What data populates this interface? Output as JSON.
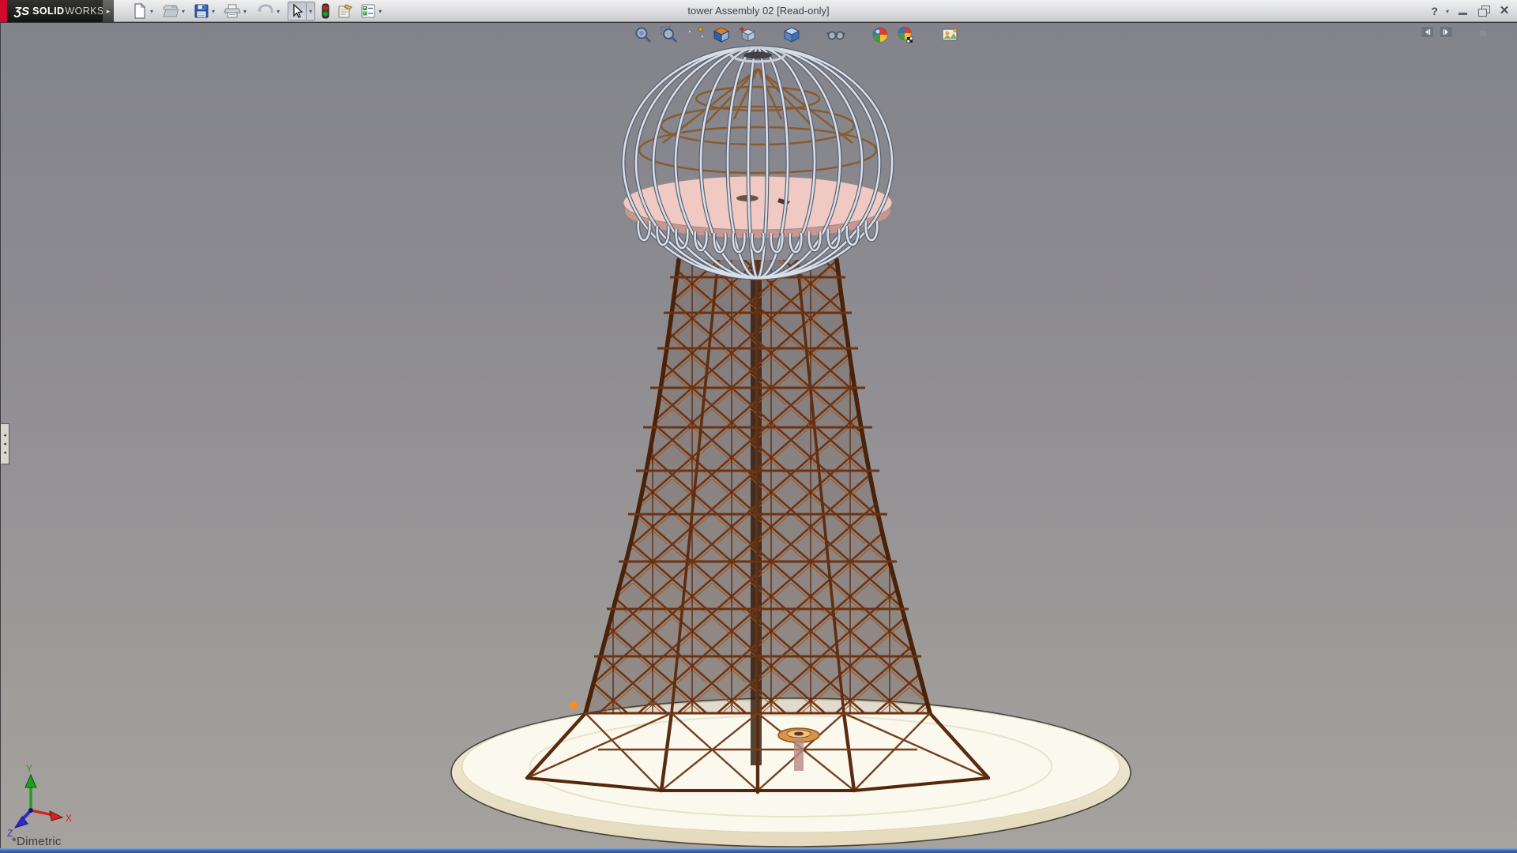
{
  "window": {
    "title": "tower Assembly 02 [Read-only]"
  },
  "brand": {
    "glyph": "ƷS",
    "bold": "SOLID",
    "light": "WORKS",
    "expand_arrow": "▸"
  },
  "titlebar_controls": {
    "help": "?",
    "help_caret": "▾",
    "minimize": "minimize",
    "restore": "restore",
    "close": "✕"
  },
  "standard_toolbar": {
    "icons": [
      "new-document",
      "open-document",
      "save",
      "print",
      "undo",
      "select-cursor",
      "appearance-stoplight",
      "design-binder",
      "options-list"
    ],
    "caret": "▾"
  },
  "heads_up_toolbar": {
    "icons": [
      "zoom-to-fit",
      "zoom-to-area",
      "section-view",
      "view-orientation",
      "standard-views",
      "display-style",
      "hide-show-items",
      "edit-appearance",
      "apply-scene",
      "view-settings"
    ]
  },
  "document_controls": {
    "icons": [
      "dock-pane-left",
      "dock-pane-right",
      "minimize",
      "restore",
      "close"
    ],
    "close": "✕"
  },
  "viewport": {
    "orientation_label": "*Dimetric",
    "triad": {
      "x": "X",
      "y": "Y",
      "z": "Z"
    },
    "model_description": "Wardenclyffe-style lattice tower with spherical cupola on circular platform"
  },
  "colors": {
    "background_top": "#83838b",
    "background_bottom": "#a6a29e",
    "tower_brown": "#7a3b16",
    "tower_dark": "#4a2209",
    "dome_silver": "#d7dce6",
    "dome_disc_pink": "#efc9c2",
    "platform_cream": "#fbf8ee",
    "platform_rim": "#ede5cc",
    "logo_red": "#cf0a2c",
    "taskbar_blue": "#3c6db6",
    "triad_x": "#d42020",
    "triad_y": "#1e9e1e",
    "triad_z": "#2b2bd0"
  }
}
